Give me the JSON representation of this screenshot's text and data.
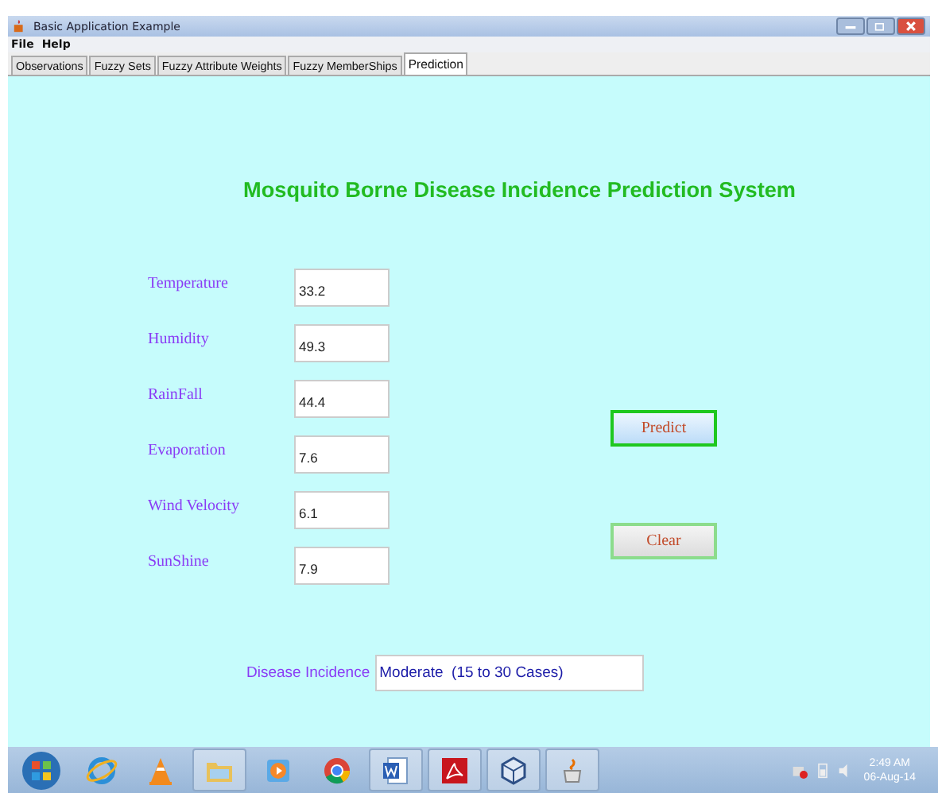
{
  "window": {
    "title": "Basic Application Example"
  },
  "menu": [
    "File",
    "Help"
  ],
  "tabs": [
    {
      "label": "Observations",
      "selected": false
    },
    {
      "label": "Fuzzy Sets",
      "selected": false
    },
    {
      "label": "Fuzzy Attribute Weights",
      "selected": false
    },
    {
      "label": "Fuzzy MemberShips",
      "selected": false
    },
    {
      "label": "Prediction",
      "selected": true
    }
  ],
  "heading": "Mosquito Borne Disease Incidence Prediction System",
  "fields": [
    {
      "label": "Temperature",
      "value": "33.2"
    },
    {
      "label": "Humidity",
      "value": "49.3"
    },
    {
      "label": "RainFall",
      "value": "44.4"
    },
    {
      "label": "Evaporation",
      "value": "7.6"
    },
    {
      "label": "Wind Velocity",
      "value": "6.1"
    },
    {
      "label": "SunShine",
      "value": "7.9"
    }
  ],
  "buttons": [
    {
      "label": "Predict",
      "focused": true
    },
    {
      "label": "Clear",
      "focused": false
    }
  ],
  "result": {
    "label": "Disease Incidence",
    "value": "Moderate  (15 to 30 Cases)"
  },
  "taskbar": {
    "time": "2:49 AM",
    "date": "06-Aug-14"
  }
}
